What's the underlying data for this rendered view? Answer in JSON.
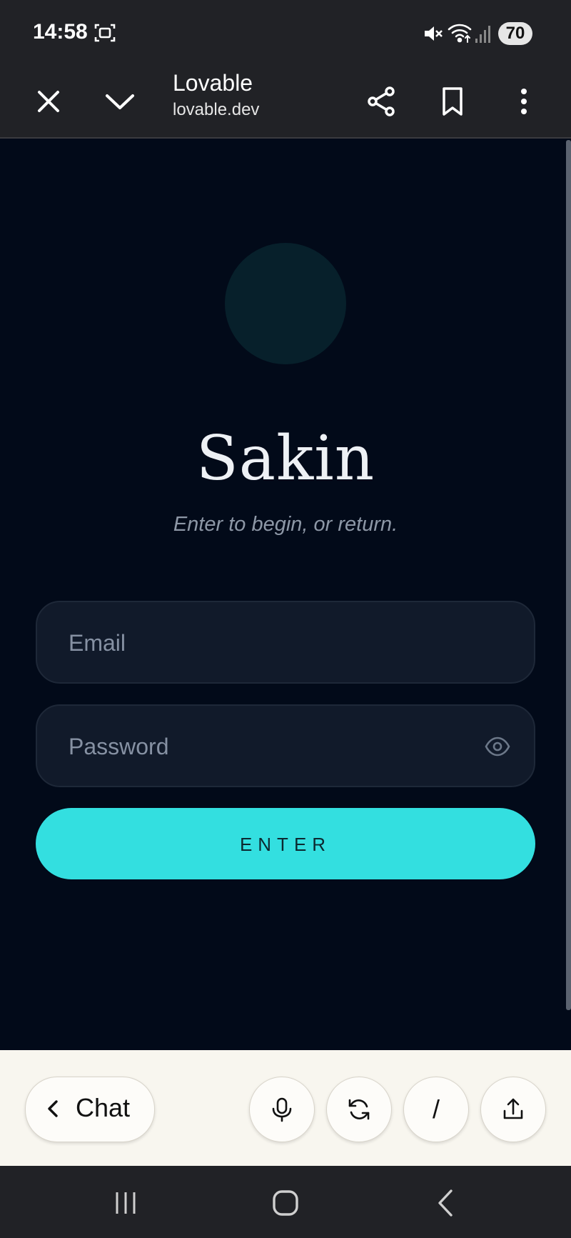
{
  "status_bar": {
    "time": "14:58",
    "battery": "70"
  },
  "browser": {
    "site_title": "Lovable",
    "site_url": "lovable.dev"
  },
  "login": {
    "app_name": "Sakin",
    "tagline": "Enter to begin, or return.",
    "email_placeholder": "Email",
    "password_placeholder": "Password",
    "enter_label": "ENTER"
  },
  "lovable_toolbar": {
    "chat_label": "Chat",
    "slash_label": "/"
  },
  "colors": {
    "page_background": "#020a19",
    "accent": "#33dfe0",
    "field_background": "#111a2a",
    "toolbar_background": "#f8f6ef"
  },
  "icons": [
    "screenshot-icon",
    "mute-icon",
    "wifi-icon",
    "signal-icon",
    "close-icon",
    "chevron-down-icon",
    "share-icon",
    "bookmark-icon",
    "more-vert-icon",
    "eye-icon",
    "chevron-left-icon",
    "mic-icon",
    "refresh-icon",
    "upload-icon",
    "recent-apps-icon",
    "home-icon",
    "back-icon"
  ]
}
